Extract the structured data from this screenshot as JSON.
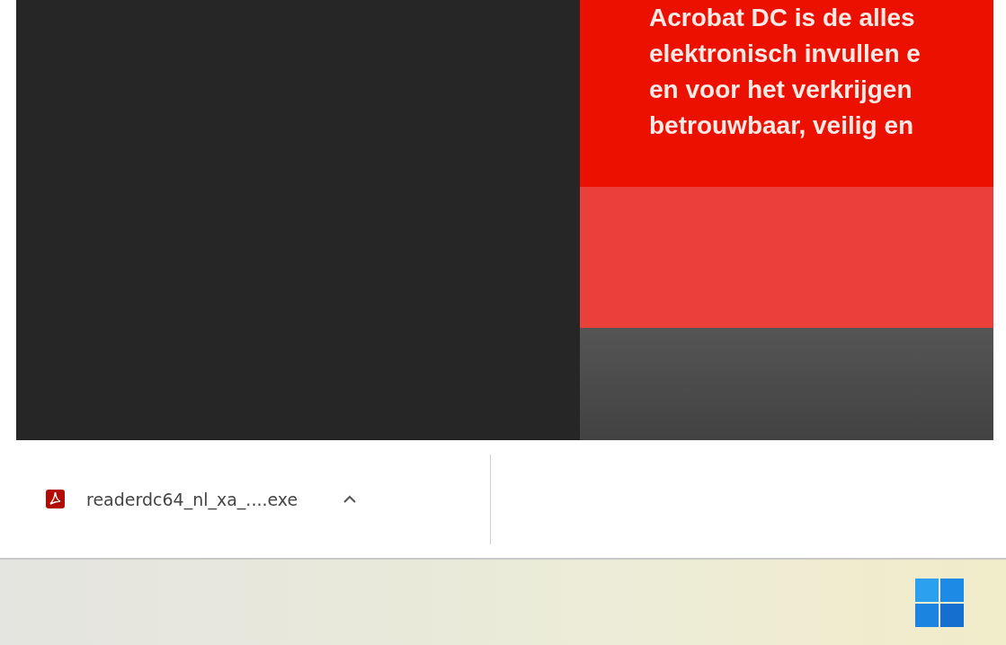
{
  "promo": {
    "lines": [
      "Acrobat DC is de alles",
      "elektronisch invullen e",
      "en voor het verkrijgen",
      "betrouwbaar, veilig en"
    ]
  },
  "download_bar": {
    "items": [
      {
        "filename": "readerdc64_nl_xa_....exe"
      }
    ]
  }
}
